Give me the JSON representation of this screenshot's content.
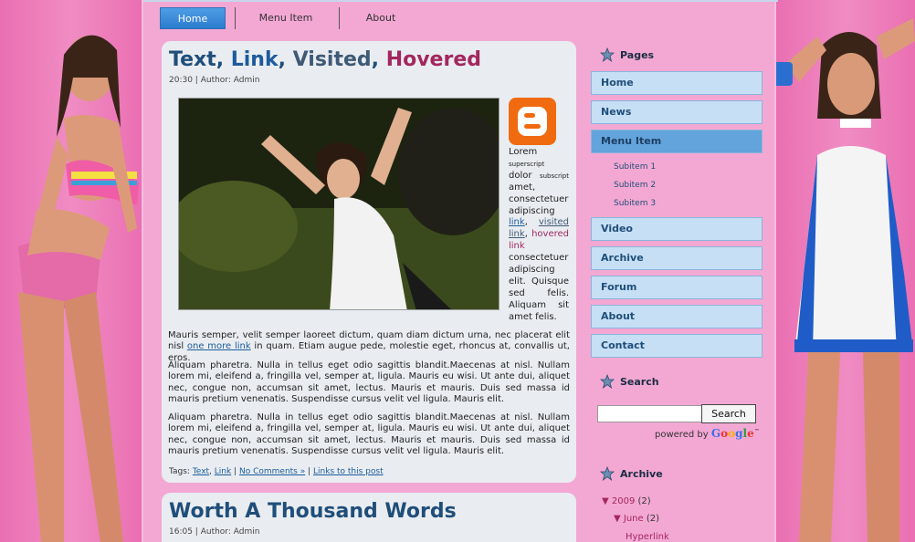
{
  "nav": {
    "tabs": [
      {
        "label": "Home",
        "active": true
      },
      {
        "label": "Menu Item",
        "active": false
      },
      {
        "label": "About",
        "active": false
      }
    ]
  },
  "posts": [
    {
      "title_parts": [
        "Text",
        ", ",
        "Link",
        ", ",
        "Visited",
        ", ",
        "Hovered"
      ],
      "time": "20:30",
      "author_label": "Author: Admin",
      "side_text": {
        "w1": "Lorem",
        "sup": "superscript",
        "w2": "dolor",
        "sub": "subscript",
        "w3": "amet, consectetuer adipiscing",
        "link": "link",
        "visited": "visited link",
        "hovered": "hovered link",
        "w4": "consectetuer adipiscing elit. Quisque sed felis. Aliquam sit amet felis."
      },
      "p1_before": "Mauris semper, velit semper laoreet dictum, quam diam dictum urna, nec placerat elit nisl",
      "p1_link": "one more link",
      "p1_after": "in quam. Etiam augue pede, molestie eget, rhoncus at, convallis ut, eros.",
      "p2": "Aliquam pharetra. Nulla in tellus eget odio sagittis blandit.Maecenas at nisl. Nullam lorem mi, eleifend a, fringilla vel, semper at, ligula. Mauris eu wisi. Ut ante dui, aliquet nec, congue non, accumsan sit amet, lectus. Mauris et mauris. Duis sed massa id mauris pretium venenatis. Suspendisse cursus velit vel ligula. Mauris elit.",
      "p3": "Aliquam pharetra. Nulla in tellus eget odio sagittis blandit.Maecenas at nisl. Nullam lorem mi, eleifend a, fringilla vel, semper at, ligula. Mauris eu wisi. Ut ante dui, aliquet nec, congue non, accumsan sit amet, lectus. Mauris et mauris. Duis sed massa id mauris pretium venenatis. Suspendisse cursus velit vel ligula. Mauris elit.",
      "tags_label": "Tags:",
      "tag1": "Text",
      "tag2": "Link",
      "comments": "No Comments »",
      "links": "Links to this post"
    },
    {
      "title": "Worth A Thousand Words",
      "time": "16:05",
      "author_label": "Author: Admin"
    }
  ],
  "sidebar": {
    "pages_title": "Pages",
    "items": [
      "Home",
      "News",
      "Menu Item",
      "Video",
      "Archive",
      "Forum",
      "About",
      "Contact"
    ],
    "subitems": [
      "Subitem 1",
      "Subitem 2",
      "Subitem 3"
    ],
    "search_title": "Search",
    "search_button": "Search",
    "powered_by": "powered by",
    "google": "Google",
    "archive_title": "Archive",
    "archive": {
      "year": "▼ 2009",
      "year_count": "(2)",
      "month": "▼ June",
      "month_count": "(2)",
      "post": "Hyperlink"
    }
  },
  "colors": {
    "accent": "#1f4e79",
    "hover": "#a3275f",
    "nav_bg": "#c6dff4",
    "page_bg": "#f3a8d3"
  }
}
